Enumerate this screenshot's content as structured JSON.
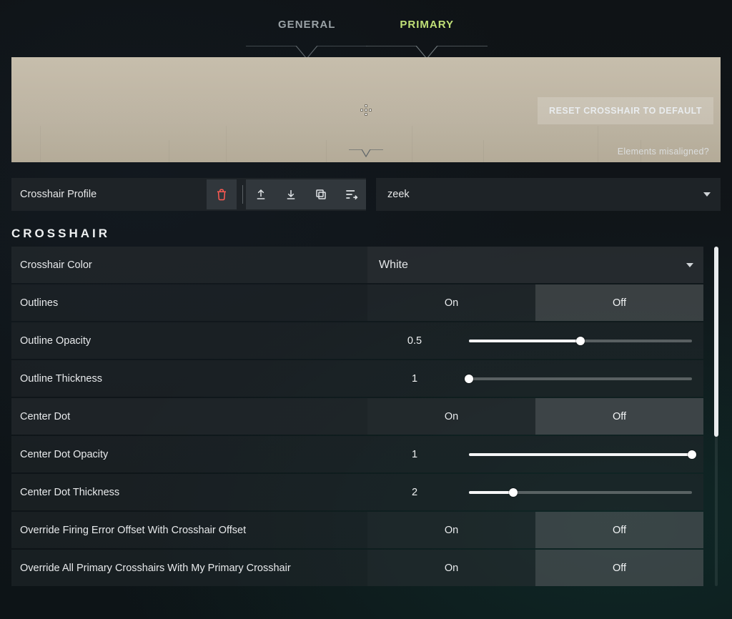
{
  "tabs": {
    "general": "GENERAL",
    "primary": "PRIMARY",
    "active": "primary"
  },
  "preview": {
    "reset_label": "RESET CROSSHAIR TO DEFAULT",
    "misaligned_label": "Elements misaligned?"
  },
  "profile": {
    "label": "Crosshair Profile",
    "selected": "zeek",
    "tools": {
      "delete": "delete",
      "upload": "upload",
      "download": "download",
      "copy": "copy",
      "sort": "sort"
    }
  },
  "section_title": "CROSSHAIR",
  "toggle_labels": {
    "on": "On",
    "off": "Off"
  },
  "rows": {
    "color": {
      "label": "Crosshair Color",
      "value": "White"
    },
    "outlines": {
      "label": "Outlines",
      "value": "Off"
    },
    "outline_opacity": {
      "label": "Outline Opacity",
      "value": "0.5",
      "percent": 50
    },
    "outline_thickness": {
      "label": "Outline Thickness",
      "value": "1",
      "percent": 0
    },
    "center_dot": {
      "label": "Center Dot",
      "value": "Off"
    },
    "center_dot_opacity": {
      "label": "Center Dot Opacity",
      "value": "1",
      "percent": 100
    },
    "center_dot_thickness": {
      "label": "Center Dot Thickness",
      "value": "2",
      "percent": 20
    },
    "override_firing": {
      "label": "Override Firing Error Offset With Crosshair Offset",
      "value": "Off"
    },
    "override_all": {
      "label": "Override All Primary Crosshairs With My Primary Crosshair",
      "value": "Off"
    }
  }
}
